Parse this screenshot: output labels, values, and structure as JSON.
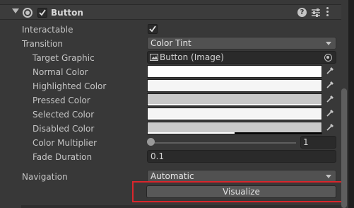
{
  "component": {
    "title": "Button",
    "enabled": true
  },
  "interactable": {
    "label": "Interactable",
    "checked": true
  },
  "transition": {
    "label": "Transition",
    "value": "Color Tint"
  },
  "target_graphic": {
    "label": "Target Graphic",
    "value": "Button (Image)"
  },
  "colors": [
    {
      "label": "Normal Color",
      "hex": "#ffffff",
      "alpha": 1.0
    },
    {
      "label": "Highlighted Color",
      "hex": "#f5f5f5",
      "alpha": 1.0
    },
    {
      "label": "Pressed Color",
      "hex": "#c8c8c8",
      "alpha": 1.0
    },
    {
      "label": "Selected Color",
      "hex": "#f5f5f5",
      "alpha": 1.0
    },
    {
      "label": "Disabled Color",
      "hex": "#c8c8c8",
      "alpha": 0.5
    }
  ],
  "color_multiplier": {
    "label": "Color Multiplier",
    "value": "1",
    "slider_fraction": 0.0
  },
  "fade_duration": {
    "label": "Fade Duration",
    "value": "0.1"
  },
  "navigation": {
    "label": "Navigation",
    "value": "Automatic"
  },
  "visualize": {
    "label": "Visualize",
    "highlight_color": "#d9262c"
  }
}
